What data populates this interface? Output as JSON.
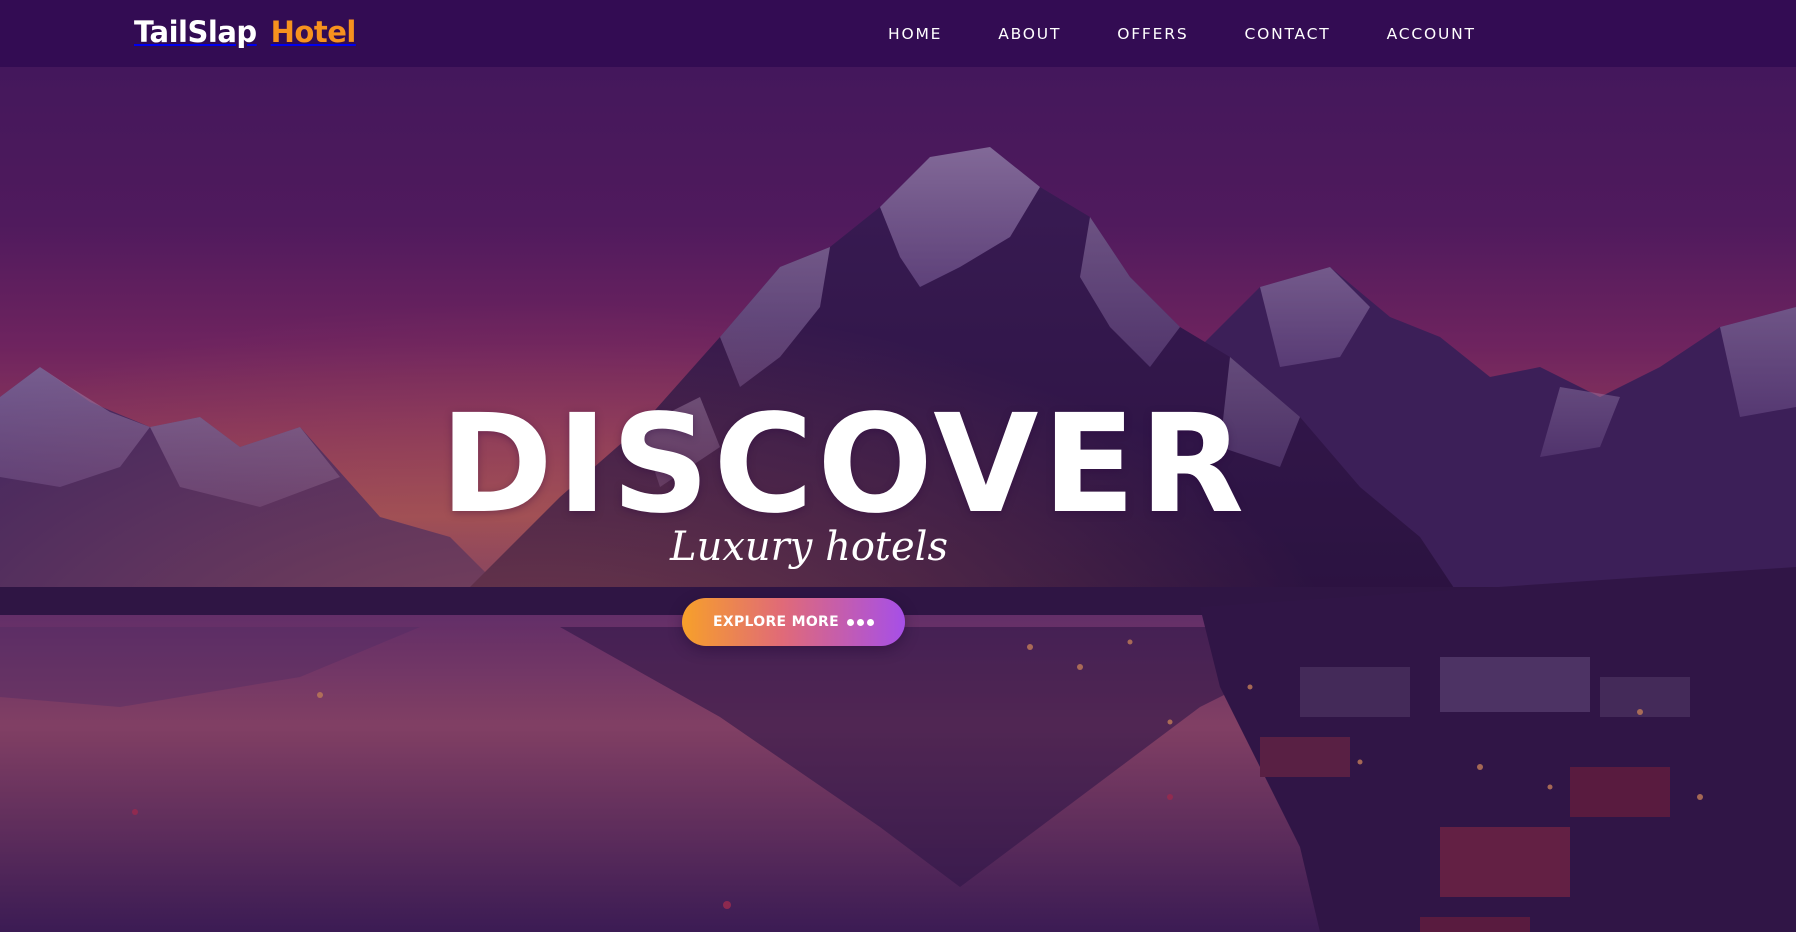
{
  "brand": {
    "part1": "TailSlap",
    "part2": "Hotel"
  },
  "nav": {
    "items": [
      {
        "label": "HOME"
      },
      {
        "label": "ABOUT"
      },
      {
        "label": "OFFERS"
      },
      {
        "label": "CONTACT"
      },
      {
        "label": "ACCOUNT"
      }
    ]
  },
  "hero": {
    "headline": "DISCOVER",
    "tagline": "Luxury hotels",
    "cta_label": "EXPLORE MORE",
    "background": "mountain-lake-sunset-image"
  },
  "colors": {
    "navbar_bg": "#330c53",
    "brand_accent": "#f7921e",
    "cta_gradient_start": "#f7a02a",
    "cta_gradient_end": "#a64fe8",
    "text": "#ffffff"
  }
}
